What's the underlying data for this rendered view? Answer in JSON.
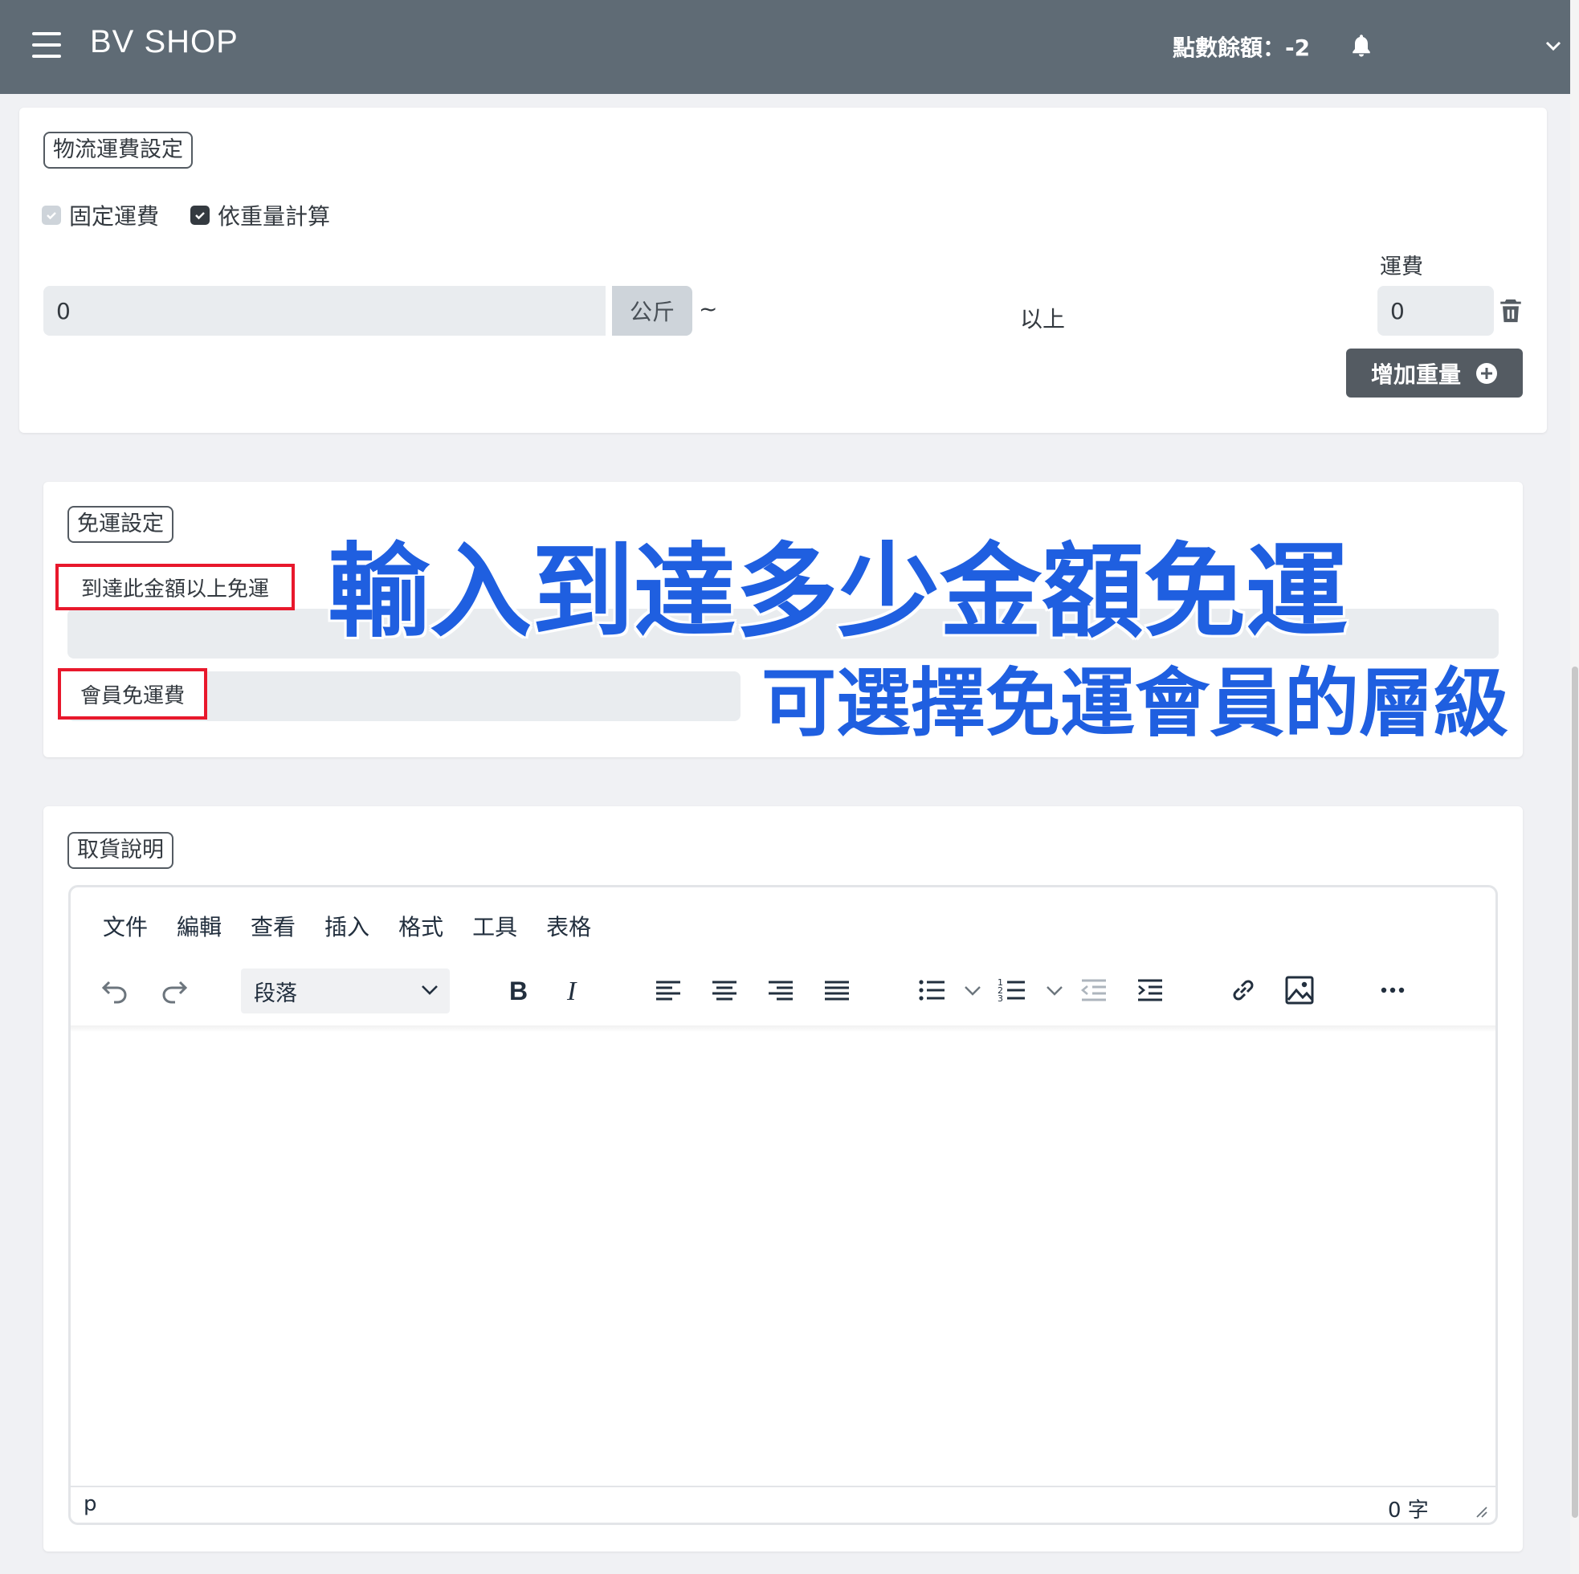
{
  "topbar": {
    "brand": "BV SHOP",
    "points_label": "點數餘額：-2"
  },
  "shipping": {
    "section_title": "物流運費設定",
    "fixed_label": "固定運費",
    "weight_label": "依重量計算",
    "weight_value": "0",
    "weight_unit": "公斤",
    "range_sep": "~",
    "above_label": "以上",
    "fee_header": "運費",
    "fee_value": "0",
    "add_weight_label": "增加重量"
  },
  "free_shipping": {
    "section_title": "免運設定",
    "threshold_label": "到達此金額以上免運",
    "member_label": "會員免運費",
    "annotation_1": "輸入到達多少金額免運",
    "annotation_2": "可選擇免運會員的層級",
    "annotation_color": "#1f5fe0",
    "highlight_color": "#e8182c"
  },
  "pickup": {
    "section_title": "取貨說明",
    "menu": [
      "文件",
      "編輯",
      "查看",
      "插入",
      "格式",
      "工具",
      "表格"
    ],
    "block_format": "段落",
    "status_path": "p",
    "word_count": "0 字"
  }
}
